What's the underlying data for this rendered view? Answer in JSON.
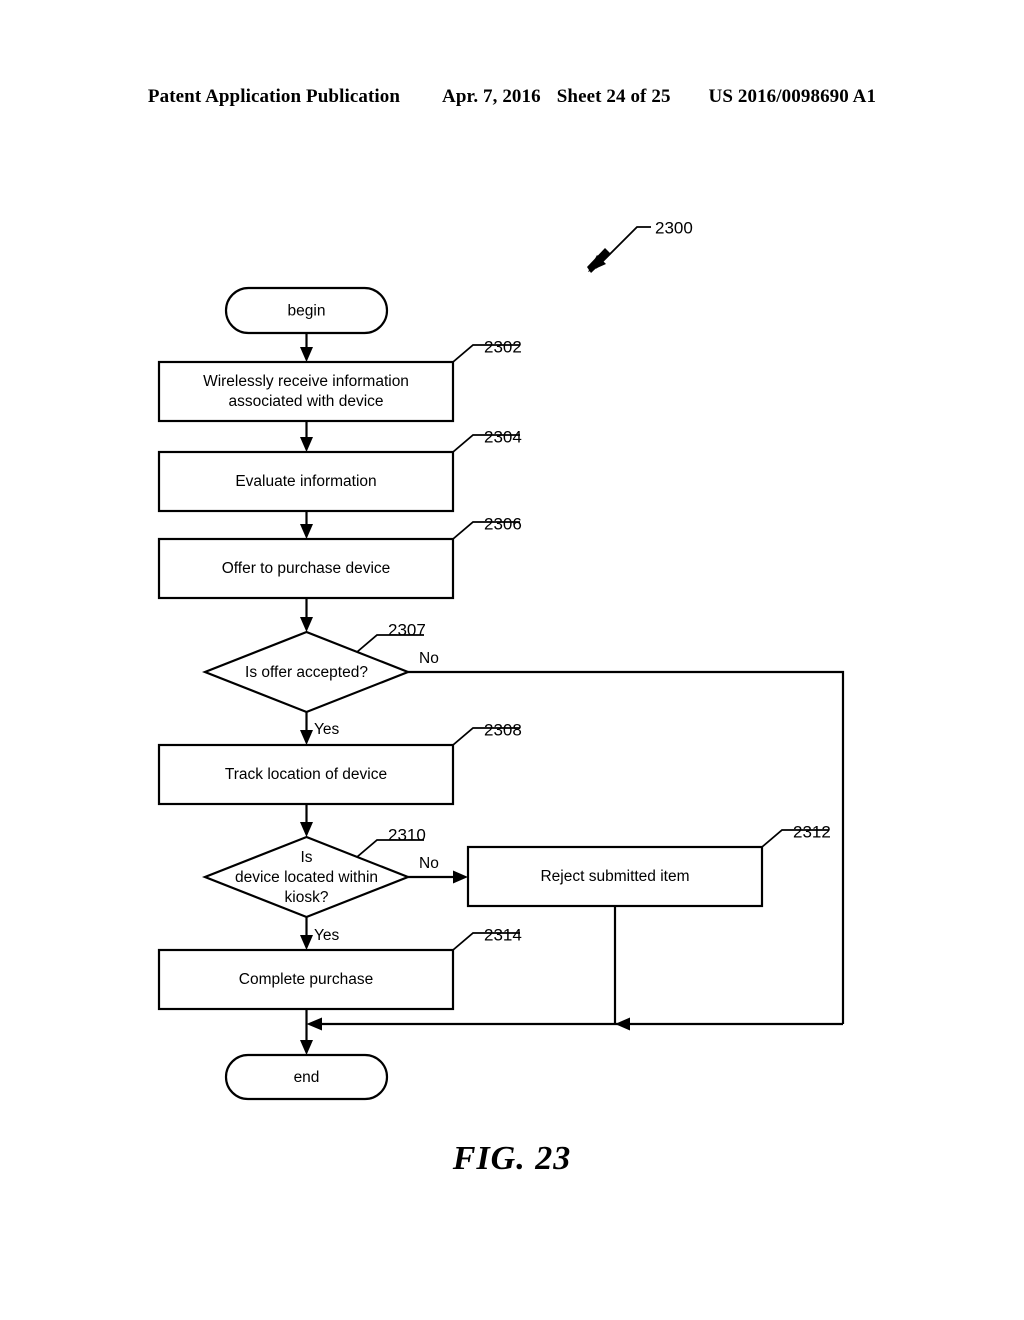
{
  "header": {
    "publication": "Patent Application Publication",
    "date": "Apr. 7, 2016",
    "sheet": "Sheet 24 of 25",
    "patent_number": "US 2016/0098690 A1"
  },
  "figure": {
    "caption": "FIG. 23",
    "diagram_reference": "2300"
  },
  "flowchart": {
    "nodes": {
      "begin": {
        "label": "begin"
      },
      "receive_info": {
        "ref": "2302",
        "line1": "Wirelessly receive information",
        "line2": "associated with device"
      },
      "evaluate": {
        "ref": "2304",
        "label": "Evaluate information"
      },
      "offer": {
        "ref": "2306",
        "label": "Offer to purchase device"
      },
      "offer_accepted": {
        "ref": "2307",
        "label": "Is offer accepted?"
      },
      "track_location": {
        "ref": "2308",
        "label": "Track location of device"
      },
      "within_kiosk": {
        "ref": "2310",
        "line1": "Is",
        "line2": "device located within",
        "line3": "kiosk?"
      },
      "reject_item": {
        "ref": "2312",
        "label": "Reject submitted item"
      },
      "complete_purchase": {
        "ref": "2314",
        "label": "Complete purchase"
      },
      "end": {
        "label": "end"
      }
    },
    "branch_labels": {
      "offer_accepted_no": "No",
      "offer_accepted_yes": "Yes",
      "within_kiosk_no": "No",
      "within_kiosk_yes": "Yes"
    }
  }
}
